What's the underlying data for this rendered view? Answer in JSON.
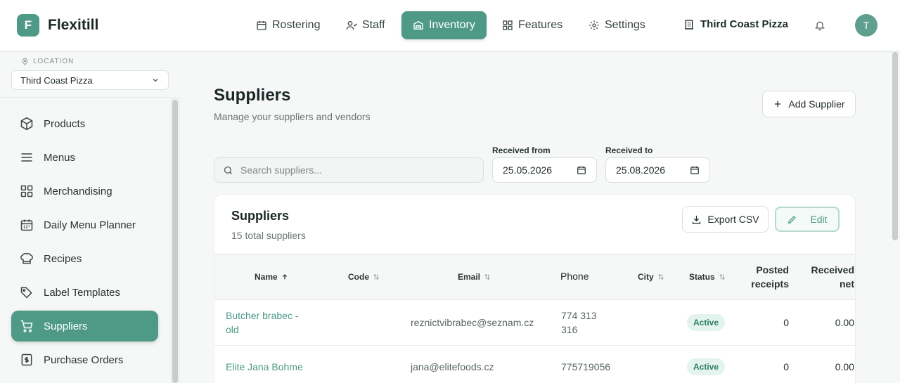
{
  "app": {
    "logo_letter": "F",
    "name": "Flexitill"
  },
  "topnav": [
    {
      "label": "Rostering",
      "icon": "calendar-icon"
    },
    {
      "label": "Staff",
      "icon": "users-icon"
    },
    {
      "label": "Inventory",
      "icon": "warehouse-icon",
      "active": true
    },
    {
      "label": "Features",
      "icon": "grid-icon"
    },
    {
      "label": "Settings",
      "icon": "gear-icon"
    }
  ],
  "store": {
    "name": "Third Coast Pizza",
    "icon": "building-icon"
  },
  "user": {
    "initial": "T"
  },
  "sidebar": {
    "location_label": "LOCATION",
    "location_value": "Third Coast Pizza",
    "items": [
      {
        "label": "Products",
        "icon": "box-icon"
      },
      {
        "label": "Menus",
        "icon": "menu-lines-icon"
      },
      {
        "label": "Merchandising",
        "icon": "grid-icon"
      },
      {
        "label": "Daily Menu Planner",
        "icon": "calendar-icon"
      },
      {
        "label": "Recipes",
        "icon": "chef-hat-icon"
      },
      {
        "label": "Label Templates",
        "icon": "tags-icon"
      },
      {
        "label": "Suppliers",
        "icon": "cart-icon",
        "active": true
      },
      {
        "label": "Purchase Orders",
        "icon": "receipt-icon"
      }
    ]
  },
  "page": {
    "title": "Suppliers",
    "subtitle": "Manage your suppliers and vendors",
    "add_button": "Add Supplier"
  },
  "filters": {
    "search_placeholder": "Search suppliers...",
    "received_from_label": "Received from",
    "received_from_value": "25.05.2026",
    "received_to_label": "Received to",
    "received_to_value": "25.08.2026"
  },
  "table_card": {
    "title": "Suppliers",
    "subtitle": "15 total suppliers",
    "export_button": "Export CSV",
    "edit_button": "Edit",
    "columns": {
      "name": "Name",
      "code": "Code",
      "email": "Email",
      "phone": "Phone",
      "city": "City",
      "status": "Status",
      "posted_receipts_1": "Posted",
      "posted_receipts_2": "receipts",
      "received_net_1": "Received",
      "received_net_2": "net"
    },
    "rows": [
      {
        "name_1": "Butcher brabec -",
        "name_2": "old",
        "code": "",
        "email": "reznictvibrabec@seznam.cz",
        "phone_1": "774 313",
        "phone_2": "316",
        "city": "",
        "status": "Active",
        "posted_receipts": "0",
        "received_net": "0.00"
      },
      {
        "name_1": "Elite Jana Bohme",
        "name_2": "",
        "code": "",
        "email": "jana@elitefoods.cz",
        "phone_1": "775719056",
        "phone_2": "",
        "city": "",
        "status": "Active",
        "posted_receipts": "0",
        "received_net": "0.00"
      }
    ]
  },
  "colors": {
    "accent": "#4e9a87",
    "badge_bg": "#e3f3ed",
    "badge_text": "#2f7d68"
  }
}
